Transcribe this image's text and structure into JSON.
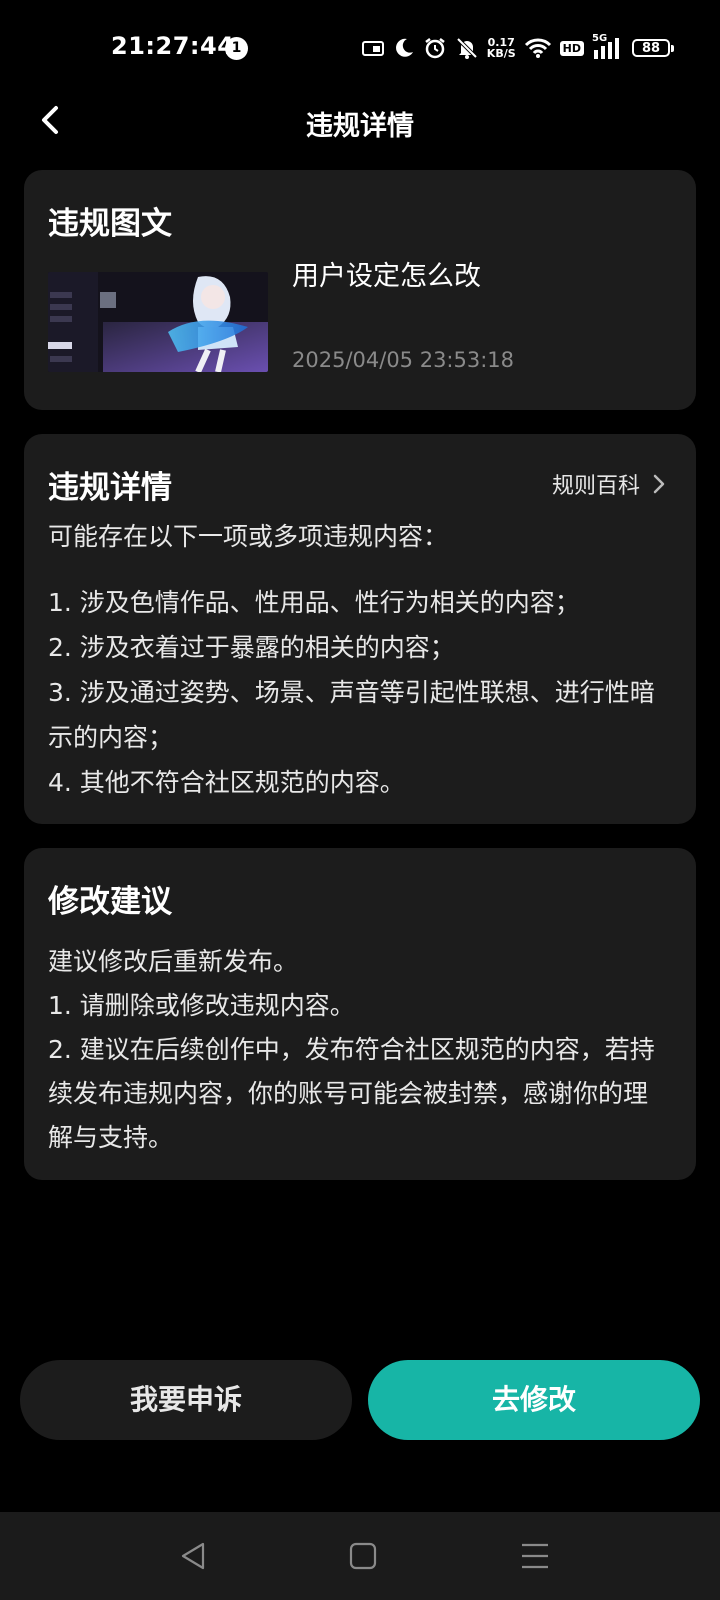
{
  "status_bar": {
    "time": "21:27:44",
    "notification_count": "1",
    "net_speed_value": "0.17",
    "net_speed_unit": "KB/S",
    "hd_label": "HD",
    "signal_label": "5G",
    "battery": "88"
  },
  "header": {
    "title": "违规详情"
  },
  "violation_post": {
    "section_title": "违规图文",
    "post_title": "用户设定怎么改",
    "timestamp": "2025/04/05 23:53:18"
  },
  "violation_details": {
    "section_title": "违规详情",
    "rules_link": "规则百科",
    "intro": "可能存在以下一项或多项违规内容：",
    "items": [
      "1. 涉及色情作品、性用品、性行为相关的内容；",
      "2. 涉及衣着过于暴露的相关的内容；",
      "3. 涉及通过姿势、场景、声音等引起性联想、进行性暗示的内容；",
      "4. 其他不符合社区规范的内容。"
    ]
  },
  "suggestions": {
    "section_title": "修改建议",
    "lines": [
      "建议修改后重新发布。",
      "1. 请删除或修改违规内容。",
      "2. 建议在后续创作中，发布符合社区规范的内容，若持续发布违规内容，你的账号可能会被封禁，感谢你的理解与支持。"
    ]
  },
  "actions": {
    "appeal_label": "我要申诉",
    "edit_label": "去修改"
  },
  "colors": {
    "accent": "#17b5a6",
    "card_bg": "#1c1c1c",
    "muted_text": "#8a8a8a"
  }
}
